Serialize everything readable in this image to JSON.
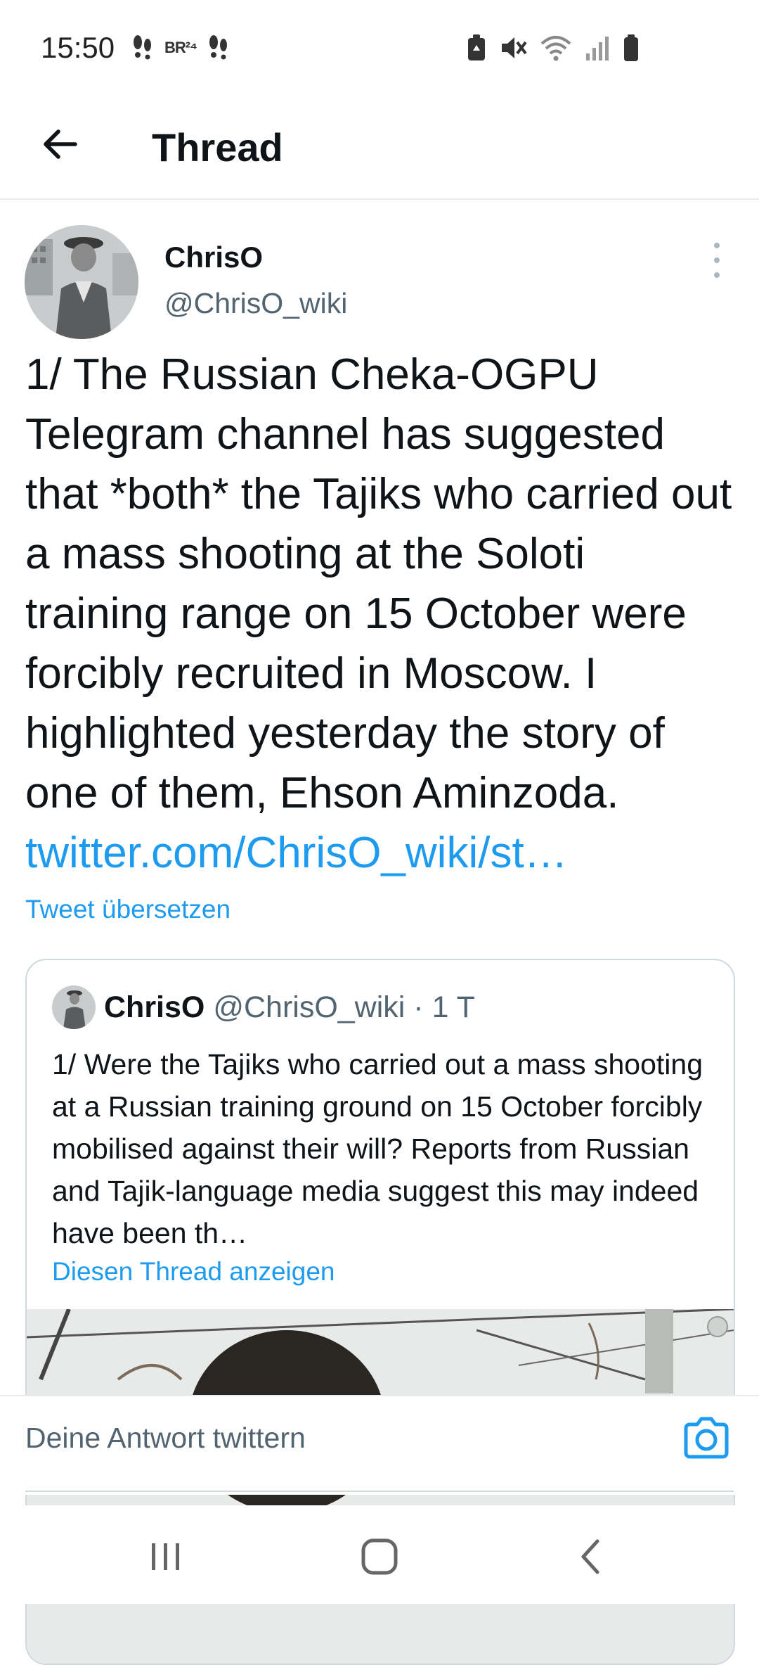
{
  "status_bar": {
    "time": "15:50",
    "left_icons": [
      "footsteps-icon",
      "br24-icon",
      "footsteps-icon"
    ],
    "br24_label": "BR²⁴",
    "right_icons": [
      "battery-saver-icon",
      "mute-icon",
      "wifi-icon",
      "signal-icon",
      "battery-icon"
    ]
  },
  "header": {
    "title": "Thread",
    "back_icon": "arrow-left-icon"
  },
  "tweet": {
    "author_name": "ChrisO",
    "author_handle": "@ChrisO_wiki",
    "text": "1/ The Russian Cheka-OGPU Telegram channel has suggested that *both* the Tajiks who carried out a mass shooting at the Soloti training range on 15 October were forcibly recruited in Moscow. I highlighted yesterday the story of one of them, Ehson Aminzoda.",
    "link": "twitter.com/ChrisO_wiki/st…",
    "translate_label": "Tweet übersetzen"
  },
  "quoted_tweet": {
    "author_name": "ChrisO",
    "author_handle": "@ChrisO_wiki",
    "meta": "· 1 T",
    "text": "1/ Were the Tajiks who carried out a mass shooting at a Russian training ground on 15 October forcibly mobilised against their will? Reports from Russian and Tajik-language media suggest this may indeed have been th…",
    "thread_link": "Diesen Thread anzeigen"
  },
  "reply_bar": {
    "placeholder": "Deine Antwort twittern",
    "camera_icon": "camera-icon"
  },
  "nav_bar": {
    "icons": [
      "recent-apps-icon",
      "home-icon",
      "back-icon"
    ]
  },
  "colors": {
    "accent": "#1d9bf0",
    "text_primary": "#0f1419",
    "text_secondary": "#536471",
    "divider": "#e6ecf0"
  }
}
